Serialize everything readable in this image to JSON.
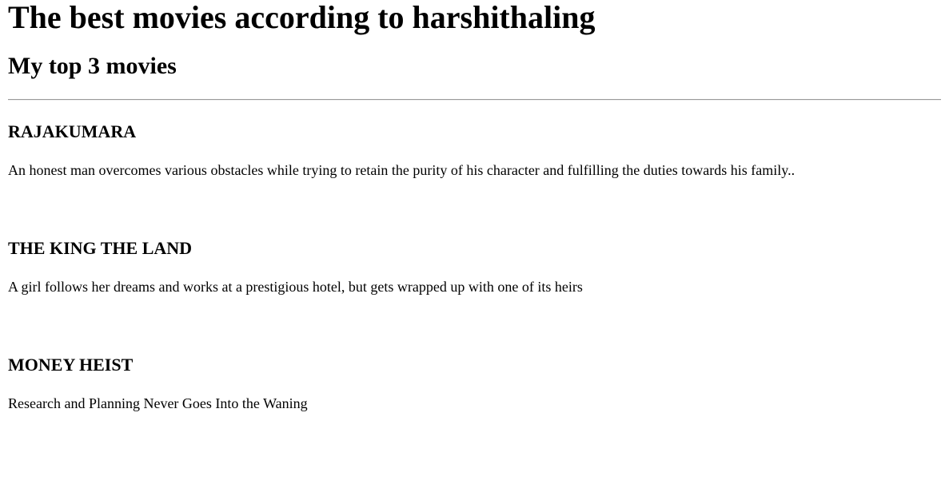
{
  "page": {
    "title": "The best movies according to harshithaling",
    "subtitle": "My top 3 movies"
  },
  "movies": [
    {
      "name": "RAJAKUMARA",
      "description": "An honest man overcomes various obstacles while trying to retain the purity of his character and fulfilling the duties towards his family.."
    },
    {
      "name": "THE KING THE LAND",
      "description": "A girl follows her dreams and works at a prestigious hotel, but gets wrapped up with one of its heirs"
    },
    {
      "name": "MONEY HEIST",
      "description": "Research and Planning Never Goes Into the Waning"
    }
  ]
}
